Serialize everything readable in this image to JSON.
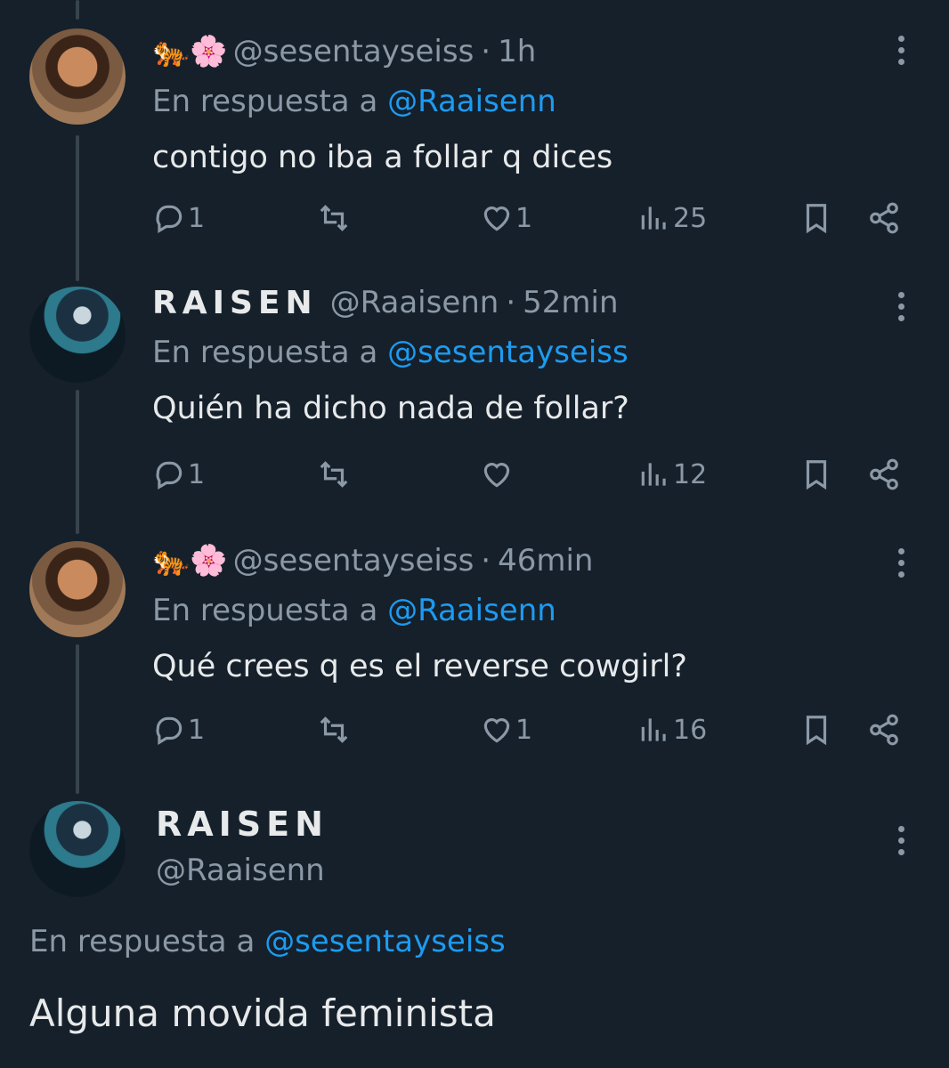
{
  "tweets": [
    {
      "emoji": "🐅🌸",
      "handle": "@sesentayseiss",
      "time": "1h",
      "reply_prefix": "En respuesta a",
      "reply_to": "@Raaisenn",
      "text": "contigo no iba a follar q dices",
      "replies": "1",
      "retweets": "",
      "likes": "1",
      "views": "25"
    },
    {
      "name": "RAISEN",
      "handle": "@Raaisenn",
      "time": "52min",
      "reply_prefix": "En respuesta a",
      "reply_to": "@sesentayseiss",
      "text": "Quién ha dicho nada de follar?",
      "replies": "1",
      "retweets": "",
      "likes": "",
      "views": "12"
    },
    {
      "emoji": "🐅🌸",
      "handle": "@sesentayseiss",
      "time": "46min",
      "reply_prefix": "En respuesta a",
      "reply_to": "@Raaisenn",
      "text": "Qué crees q es el reverse cowgirl?",
      "replies": "1",
      "retweets": "",
      "likes": "1",
      "views": "16"
    }
  ],
  "main_tweet": {
    "name": "RAISEN",
    "handle": "@Raaisenn",
    "reply_prefix": "En respuesta a",
    "reply_to": "@sesentayseiss",
    "text": "Alguna movida feminista"
  },
  "icons": [
    "reply-icon",
    "retweet-icon",
    "like-icon",
    "views-icon",
    "bookmark-icon",
    "share-icon",
    "more-icon"
  ],
  "colors": {
    "background": "#15202b",
    "muted": "#8b98a5",
    "accent": "#1d9bf0",
    "text": "#e7e9ea"
  }
}
